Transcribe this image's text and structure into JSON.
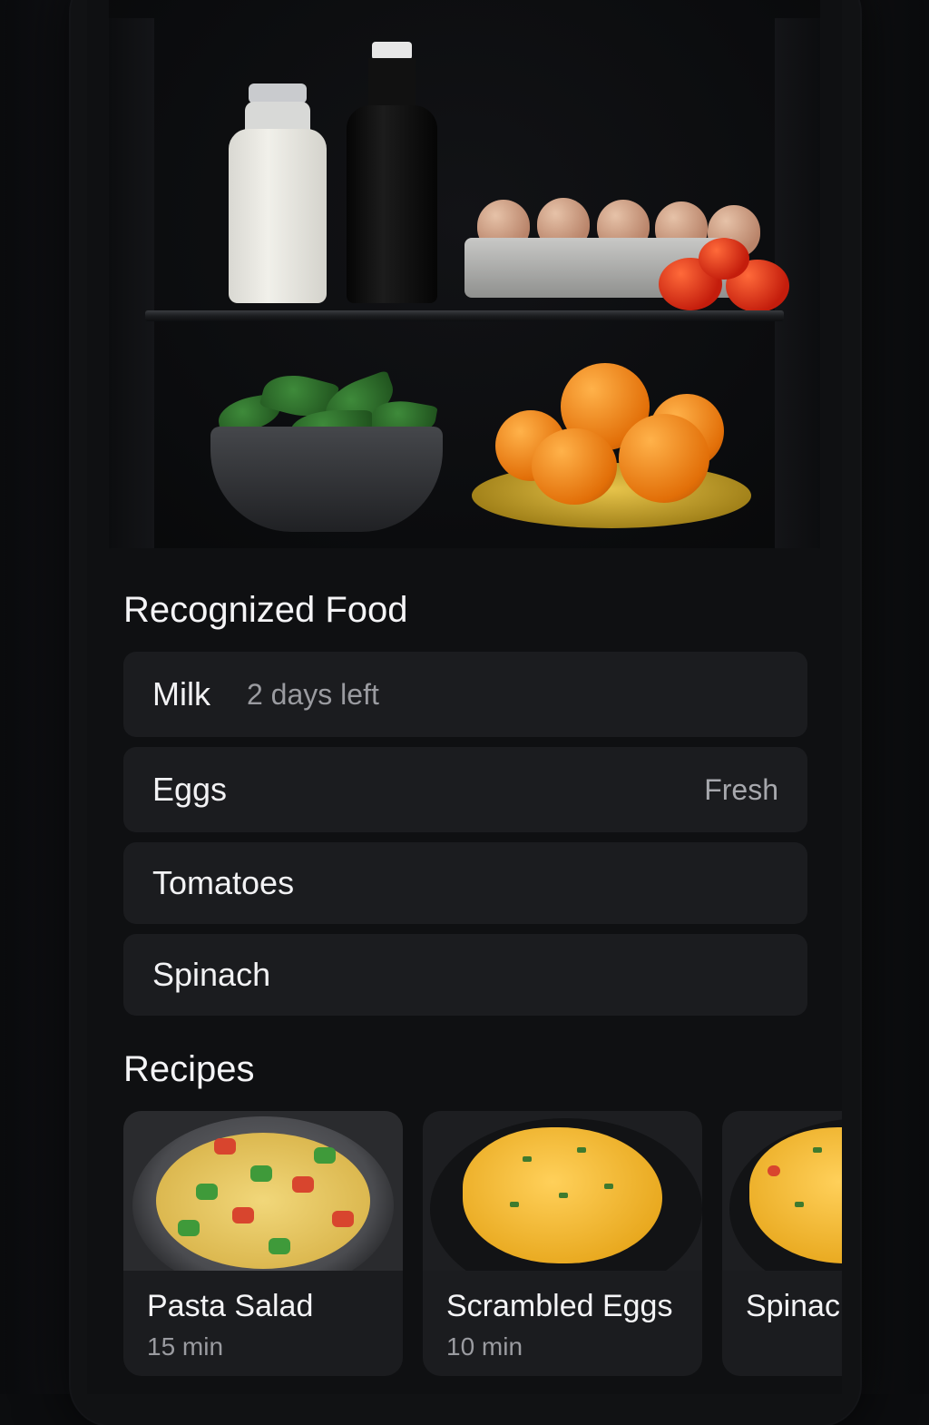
{
  "recognized_food": {
    "title": "Recognized Food",
    "items": [
      {
        "name": "Milk",
        "status": "2 days left"
      },
      {
        "name": "Eggs",
        "status": "Fresh"
      },
      {
        "name": "Tomatoes",
        "status": ""
      },
      {
        "name": "Spinach",
        "status": ""
      }
    ]
  },
  "recipes": {
    "title": "Recipes",
    "cards": [
      {
        "title": "Pasta Salad",
        "time": "15 min"
      },
      {
        "title": "Scrambled Eggs",
        "time": "10 min"
      },
      {
        "title": "Spinach",
        "time": ""
      }
    ]
  }
}
